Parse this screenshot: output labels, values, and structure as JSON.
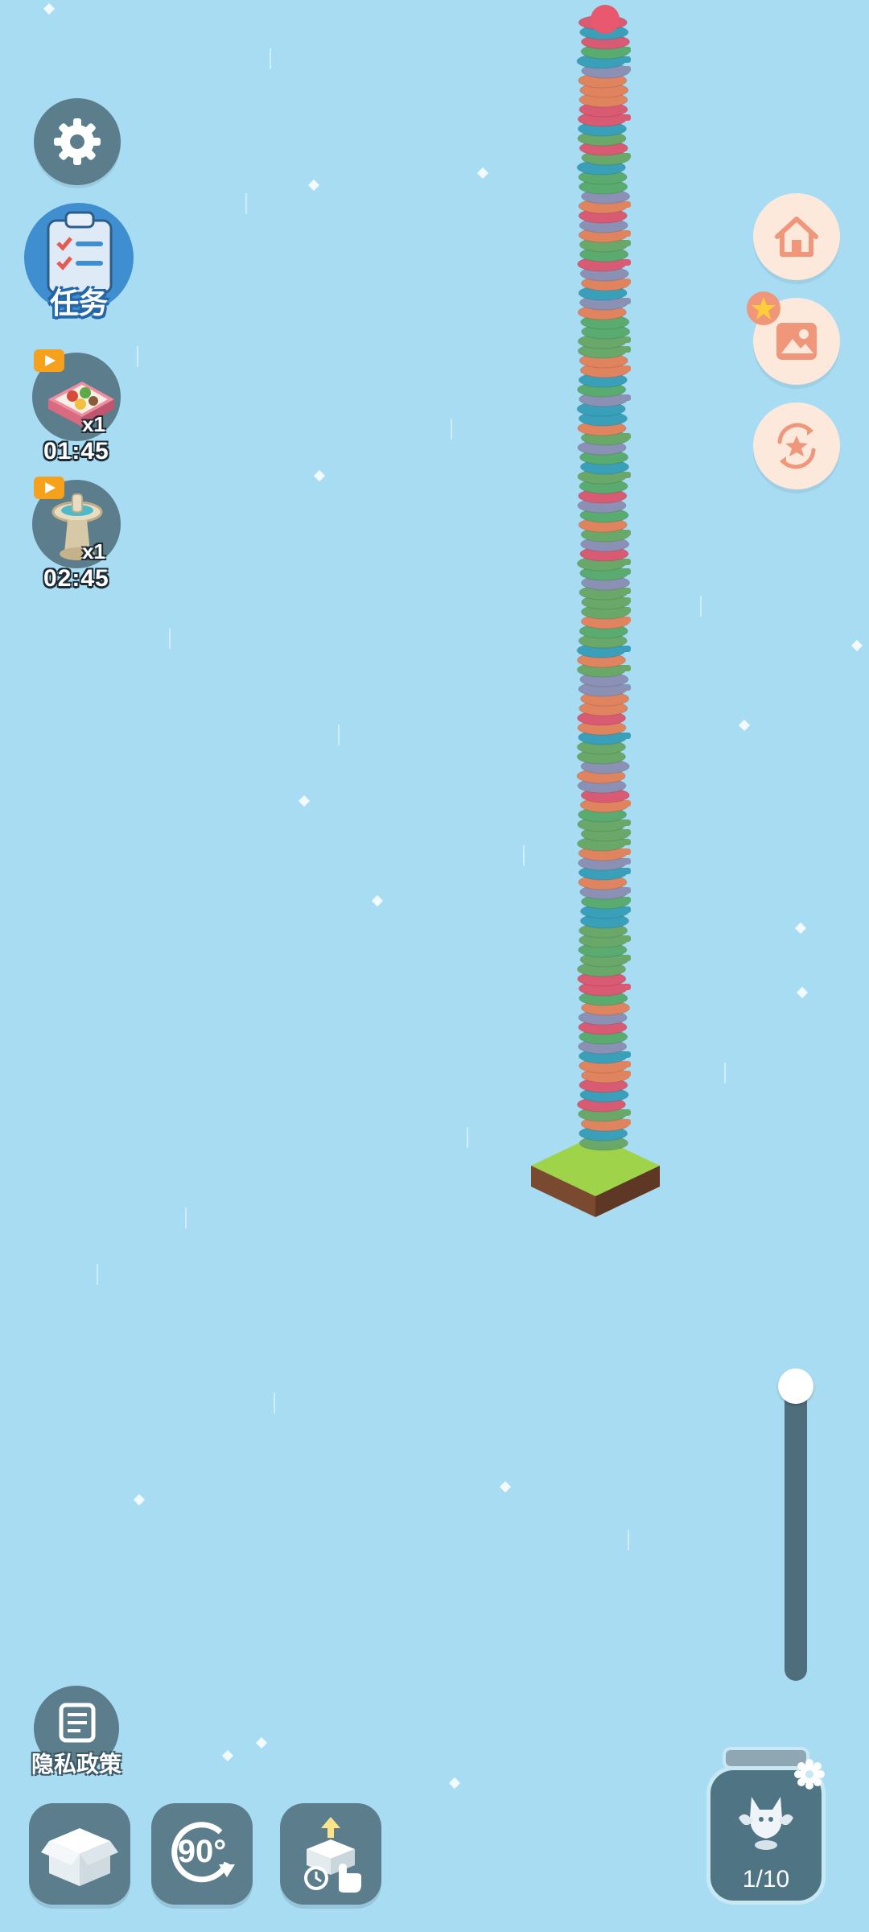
{
  "left_panel": {
    "tasks_label": "任务",
    "powerups": [
      {
        "name": "bento-box-icon",
        "count": "x1",
        "timer": "01:45"
      },
      {
        "name": "fountain-icon",
        "count": "x1",
        "timer": "02:45"
      }
    ],
    "privacy_label": "隐私政策"
  },
  "bottom_bar": {
    "rotate_label": "90°"
  },
  "collection_jar": {
    "progress_text": "1/10"
  },
  "zoom_slider": {
    "level": 1.0
  },
  "tower": {
    "block_colors": [
      "#e0835f",
      "#3aa0ba",
      "#6aa86a",
      "#d95a73",
      "#8b91b5",
      "#5aab70"
    ]
  },
  "colors": {
    "background": "#a8dcf3",
    "button_dark": "#5b7d8c",
    "button_light": "#fde9dc",
    "accent_orange": "#f0967a"
  }
}
